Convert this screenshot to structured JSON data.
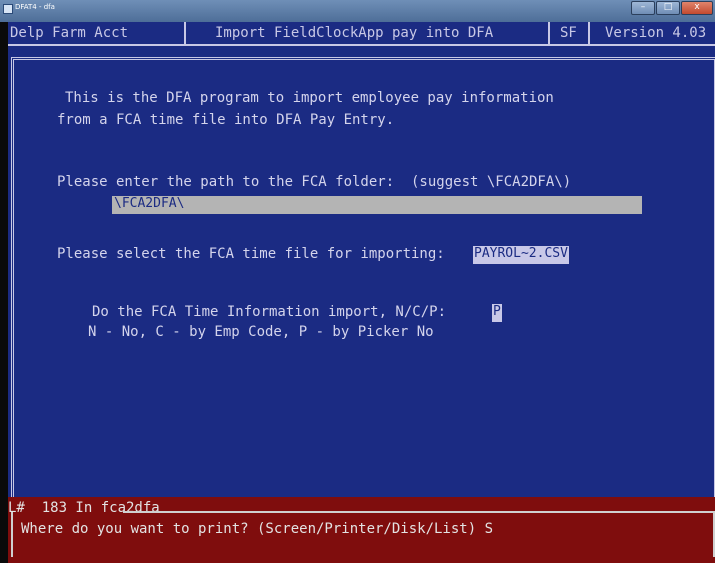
{
  "window": {
    "title": "DFAT4 - dfa",
    "controls": [
      "–",
      "□",
      "x"
    ]
  },
  "header": {
    "company": "Delp Farm Acct",
    "program_title": "Import FieldClockApp pay into DFA",
    "code": "SF",
    "version": "Version 4.03"
  },
  "intro": {
    "line1": "This is the DFA program to import employee pay information",
    "line2": "from a FCA time file into DFA Pay Entry."
  },
  "folder": {
    "prompt": "Please enter the path to the FCA folder:  (suggest \\FCA2DFA\\)",
    "value": "\\FCA2DFA\\"
  },
  "time_file": {
    "prompt": "Please select the FCA time file for importing:",
    "value": "PAYROL~2.CSV"
  },
  "import_option": {
    "prompt": "Do the FCA Time Information import, N/C/P:",
    "value": "P",
    "help": "N - No, C - by Emp Code, P - by Picker No"
  },
  "status": {
    "line_label": "L#",
    "line_number": "183 In fca2dfa",
    "question": "Where do you want to print? (Screen/Printer/Disk/List) S"
  },
  "colors": {
    "screen_bg": "#1b2b83",
    "status_bg": "#7f0d0d",
    "field_bg": "#b4b4b4"
  }
}
